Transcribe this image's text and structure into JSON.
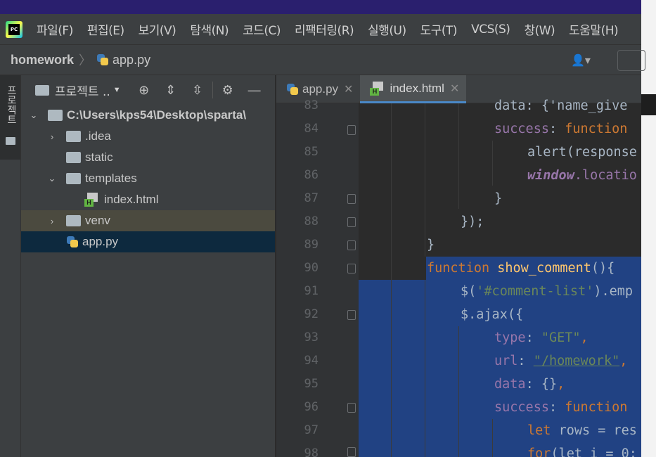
{
  "menubar": {
    "logo_text": "PC",
    "items": [
      "파일(F)",
      "편집(E)",
      "보기(V)",
      "탐색(N)",
      "코드(C)",
      "리팩터링(R)",
      "실행(U)",
      "도구(T)",
      "VCS(S)",
      "창(W)",
      "도움말(H)"
    ]
  },
  "navbar": {
    "project": "homework",
    "file": "app.py"
  },
  "sidestrip": {
    "label": "프로젝트"
  },
  "project_panel": {
    "title": "프로젝트 ..",
    "tree": [
      {
        "label": "C:\\Users\\kps54\\Desktop\\sparta\\",
        "type": "folder",
        "expanded": true
      },
      {
        "label": ".idea",
        "type": "folder",
        "expanded": false
      },
      {
        "label": "static",
        "type": "folder"
      },
      {
        "label": "templates",
        "type": "folder",
        "expanded": true
      },
      {
        "label": "index.html",
        "type": "html"
      },
      {
        "label": "venv",
        "type": "folder",
        "expanded": false
      },
      {
        "label": "app.py",
        "type": "python"
      }
    ]
  },
  "editor_tabs": [
    {
      "label": "app.py",
      "active": false
    },
    {
      "label": "index.html",
      "active": true
    }
  ],
  "line_numbers": [
    "83",
    "84",
    "85",
    "86",
    "87",
    "88",
    "89",
    "90",
    "91",
    "92",
    "93",
    "94",
    "95",
    "96",
    "97",
    "98"
  ],
  "code_text": {
    "l83": "data: {'name_give",
    "l84_key": "success",
    "l84_kw": "function",
    "l85": "alert(response",
    "l86_obj": "window",
    "l86_rest": ".locatio",
    "l87": "}",
    "l88": "});",
    "l89": "}",
    "l90_kw": "function",
    "l90_name": "show_comment",
    "l90_rest": "(){",
    "l91_a": "$(",
    "l91_str": "'#comment-list'",
    "l91_b": ").emp",
    "l92": "$.ajax({",
    "l93_key": "type",
    "l93_val": "\"GET\"",
    "l94_key": "url",
    "l94_val": "\"/homework\"",
    "l95_key": "data",
    "l95_val": "{}",
    "l96_key": "success",
    "l96_kw": "function",
    "l97_kw": "let",
    "l97_rest": "rows = res",
    "l98_kw": "for",
    "l98_rest": "(let i = 0;"
  }
}
